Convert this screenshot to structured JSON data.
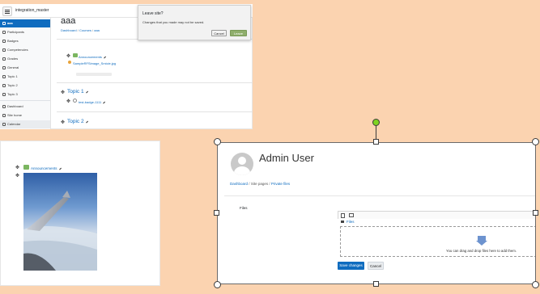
{
  "moodle": {
    "site_name": "integration_master",
    "course_title": "aaa",
    "breadcrumb": [
      "Dashboard",
      "Courses",
      "aaa"
    ],
    "breadcrumb_sep": "/",
    "sidebar": {
      "items": [
        {
          "label": "aaa",
          "icon": "cap-icon"
        },
        {
          "label": "Participants",
          "icon": "users-icon"
        },
        {
          "label": "Badges",
          "icon": "badge-icon"
        },
        {
          "label": "Competencies",
          "icon": "check-icon"
        },
        {
          "label": "Grades",
          "icon": "table-icon"
        },
        {
          "label": "General",
          "icon": "folder-icon"
        },
        {
          "label": "Topic 1",
          "icon": "folder-icon"
        },
        {
          "label": "Topic 2",
          "icon": "folder-icon"
        },
        {
          "label": "Topic 3",
          "icon": "folder-icon"
        },
        {
          "label": "Dashboard",
          "icon": "dashboard-icon"
        },
        {
          "label": "Site home",
          "icon": "home-icon"
        },
        {
          "label": "Calendar",
          "icon": "calendar-icon"
        }
      ]
    },
    "general": {
      "announcements": "Announcements",
      "file": "SampleRFSimage_Smicie.jpg"
    },
    "topic1": {
      "title": "Topic 1",
      "item": "test-badge-1111"
    },
    "topic2": {
      "title": "Topic 2"
    },
    "dialog": {
      "title": "Leave site?",
      "message": "Changes that you made may not be saved.",
      "cancel": "Cancel",
      "leave": "Leave"
    }
  },
  "preview": {
    "announcements": "Announcements"
  },
  "profile": {
    "name": "Admin User",
    "breadcrumb": [
      "Dashboard",
      "Site pages",
      "Private files"
    ],
    "breadcrumb_sep": "/",
    "files_label": "Files",
    "folder_label": "Files",
    "drop_text": "You can drag and drop files here to add them.",
    "save": "Save changes",
    "cancel": "Cancel"
  },
  "colors": {
    "background": "#FBD3B0",
    "accent": "#0f6cbf",
    "leave": "#8fae6c",
    "rotate_handle": "#7ed321"
  }
}
